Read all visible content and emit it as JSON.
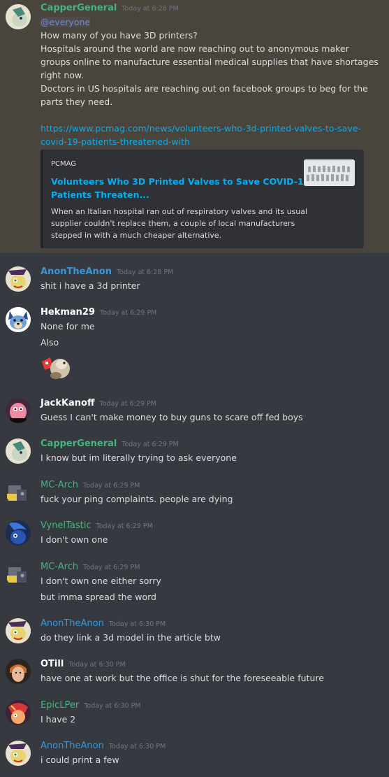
{
  "colors": {
    "background": "#36393f",
    "highlight": "#49443c",
    "name_green": "#43b581",
    "name_blue": "#3498db",
    "name_white": "#ffffff",
    "link": "#00b0f4",
    "mention": "#7289da"
  },
  "messages": [
    {
      "author": "CapperGeneral",
      "timestamp": "Today at 6:28 PM",
      "mention": "@everyone",
      "lines": [
        " How many of you have 3D printers?",
        "Hospitals around the world are now reaching out to anonymous maker",
        "groups online to manufacture essential medical supplies that have shortages",
        "right now.",
        "Doctors in US hospitals are reaching out on facebook groups to beg for the",
        "parts they need."
      ],
      "link_lines": [
        "https://www.pcmag.com/news/volunteers-who-3d-printed-valves-to-save-",
        "covid-19-patients-threatened-with"
      ],
      "embed": {
        "provider": "PCMAG",
        "title_lines": [
          "Volunteers Who 3D Printed Valves to Save COVID-19",
          "Patients Threaten..."
        ],
        "description_lines": [
          "When an Italian hospital ran out of respiratory valves and its usual",
          "supplier couldn't replace them, a couple of local manufacturers",
          "stepped in with a much cheaper alternative."
        ]
      }
    },
    {
      "author": "AnonTheAnon",
      "timestamp": "Today at 6:28 PM",
      "lines": [
        "shit i have a 3d printer"
      ]
    },
    {
      "author": "Hekman29",
      "timestamp": "Today at 6:29 PM",
      "lines": [
        "None for me",
        "Also"
      ]
    },
    {
      "author": "JackKanoff",
      "timestamp": "Today at 6:29 PM",
      "lines": [
        "Guess I can't make money to buy guns to scare off fed boys"
      ]
    },
    {
      "author": "CapperGeneral",
      "timestamp": "Today at 6:29 PM",
      "lines": [
        "I know but im literally trying to ask everyone"
      ]
    },
    {
      "author": "MC-Arch",
      "timestamp": "Today at 6:29 PM",
      "lines": [
        "fuck your ping complaints. people are dying"
      ]
    },
    {
      "author": "VynelTastic",
      "timestamp": "Today at 6:29 PM",
      "lines": [
        "I don't own one"
      ]
    },
    {
      "author": "MC-Arch",
      "timestamp": "Today at 6:29 PM",
      "lines": [
        "I don't own one either sorry",
        "but imma spread the word"
      ]
    },
    {
      "author": "AnonTheAnon",
      "timestamp": "Today at 6:30 PM",
      "lines": [
        "do they link a 3d model in the article btw"
      ]
    },
    {
      "author": "OTill",
      "timestamp": "Today at 6:30 PM",
      "lines": [
        "have one at work but the office is shut for the foreseeable future"
      ]
    },
    {
      "author": "EpicLPer",
      "timestamp": "Today at 6:30 PM",
      "lines": [
        "I have 2"
      ]
    },
    {
      "author": "AnonTheAnon",
      "timestamp": "Today at 6:30 PM",
      "lines": [
        "i could print a few"
      ]
    }
  ]
}
